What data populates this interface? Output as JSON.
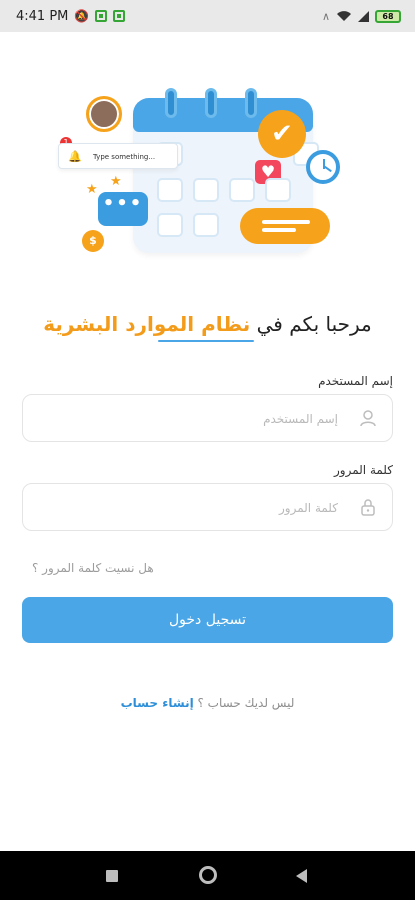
{
  "status_bar": {
    "time": "4:41 PM",
    "battery_label": "68"
  },
  "illustration": {
    "search_card_text": "Type something...",
    "notification_count": "1"
  },
  "welcome": {
    "prefix": "مرحبا بكم في ",
    "accent": "نظام الموارد البشرية",
    "accent_color": "#f39b1a"
  },
  "form": {
    "username_label": "إسم المستخدم",
    "username_placeholder": "إسم المستخدم",
    "password_label": "كلمة المرور",
    "password_placeholder": "كلمة المرور",
    "forgot_password": "هل نسيت كلمة المرور ؟",
    "login_button": "تسجيل دخول",
    "no_account": "ليس لديك حساب ؟ ",
    "create_account": "إنشاء حساب"
  },
  "colors": {
    "primary": "#4aa6e6",
    "link": "#2e8fd8"
  },
  "icons": {
    "username_field": "user-icon",
    "password_field": "lock-icon",
    "nav": [
      "recent-apps-icon",
      "home-icon",
      "back-icon"
    ]
  }
}
